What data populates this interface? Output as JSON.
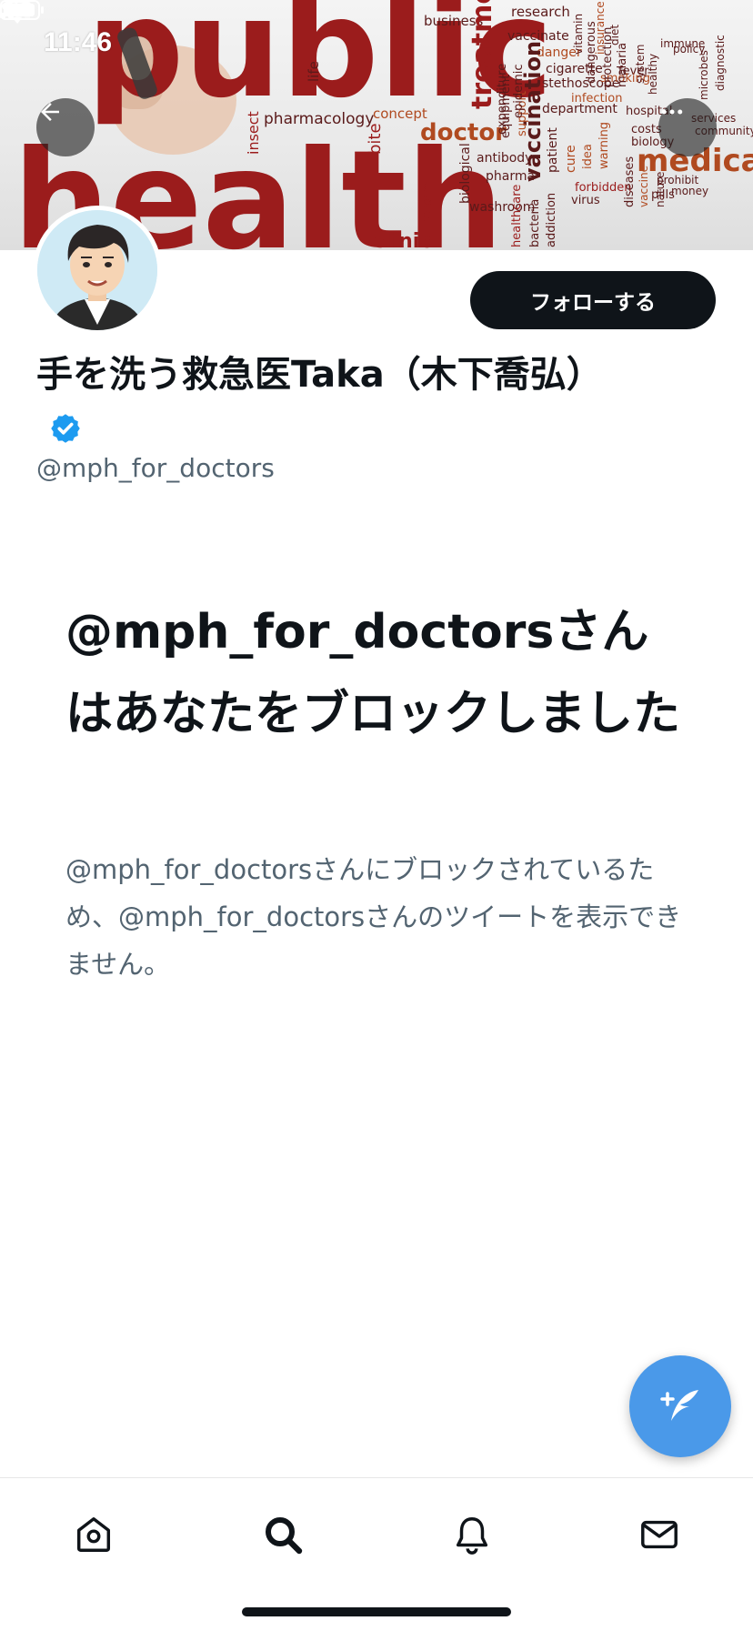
{
  "status_bar": {
    "time": "11:46"
  },
  "banner": {
    "words_large": [
      "public",
      "health"
    ],
    "words_small": [
      "business",
      "research",
      "vaccinate",
      "danger",
      "treatment",
      "cigarette",
      "stethoscope",
      "department",
      "pharmacology",
      "concept",
      "doctor",
      "insect",
      "bite",
      "infection",
      "hospital",
      "medical",
      "antibody",
      "pharma",
      "vaccination",
      "patient",
      "cure",
      "costs",
      "biology",
      "fever",
      "smoking",
      "life",
      "reform",
      "biological",
      "washroom",
      "bacteria",
      "addiction",
      "virus",
      "forbidden",
      "pills",
      "money",
      "prohibit",
      "services",
      "community",
      "microbes",
      "diagnostic",
      "clinic",
      "healthcare",
      "diseases",
      "vaccine",
      "nature",
      "idea",
      "warning",
      "equipment",
      "support",
      "dangerous",
      "protection",
      "malaria",
      "epidemic",
      "expenditure",
      "insurance",
      "diet",
      "vitamin",
      "system",
      "healthy",
      "immune",
      "policy"
    ]
  },
  "header": {
    "back_icon": "arrow-left-icon",
    "more_icon": "more-dots-icon"
  },
  "profile": {
    "display_name": "手を洗う救急医Taka（木下喬弘）",
    "handle": "@mph_for_doctors",
    "follow_label": "フォローする",
    "verified": true
  },
  "blocked": {
    "title": "@mph_for_doctorsさんはあなたをブロックしました",
    "description": "@mph_for_doctorsさんにブロックされているため、@mph_for_doctorsさんのツイートを表示できません。"
  },
  "fab": {
    "icon": "compose-tweet-icon"
  },
  "tabbar": {
    "items": [
      {
        "name": "home",
        "icon": "home-icon"
      },
      {
        "name": "search",
        "icon": "search-icon"
      },
      {
        "name": "notifications",
        "icon": "bell-icon"
      },
      {
        "name": "messages",
        "icon": "mail-icon"
      }
    ]
  },
  "colors": {
    "accent": "#1d9bf0",
    "fab": "#4a99e9",
    "text_primary": "#0f1419",
    "text_secondary": "#536471",
    "banner_red": "#9b1c1c"
  }
}
